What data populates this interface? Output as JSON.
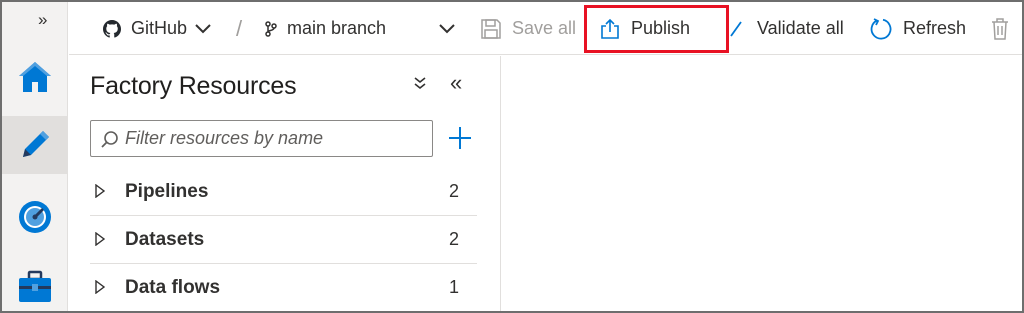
{
  "rail": {
    "collapse_glyph": "»",
    "items": [
      {
        "name": "home",
        "icon": "home-icon",
        "active": false
      },
      {
        "name": "author",
        "icon": "pencil-icon",
        "active": true
      },
      {
        "name": "monitor",
        "icon": "gauge-icon",
        "active": false
      },
      {
        "name": "manage",
        "icon": "toolbox-icon",
        "active": false
      }
    ]
  },
  "toolbar": {
    "repo_label": "GitHub",
    "separator": "/",
    "branch_label": "main branch",
    "save_all_label": "Save all",
    "publish_label": "Publish",
    "validate_all_label": "Validate all",
    "refresh_label": "Refresh",
    "highlight_color": "#e81123"
  },
  "panel": {
    "title": "Factory Resources",
    "expand_glyph": "»",
    "collapse_glyph": "«",
    "search_placeholder": "Filter resources by name",
    "add_glyph": "+",
    "items": [
      {
        "label": "Pipelines",
        "count": "2"
      },
      {
        "label": "Datasets",
        "count": "2"
      },
      {
        "label": "Data flows",
        "count": "1"
      }
    ]
  },
  "colors": {
    "accent": "#0078d4",
    "rail_bg": "#f3f2f1",
    "rail_active_bg": "#e1dfdd",
    "text": "#323130",
    "disabled": "#a19f9d"
  }
}
